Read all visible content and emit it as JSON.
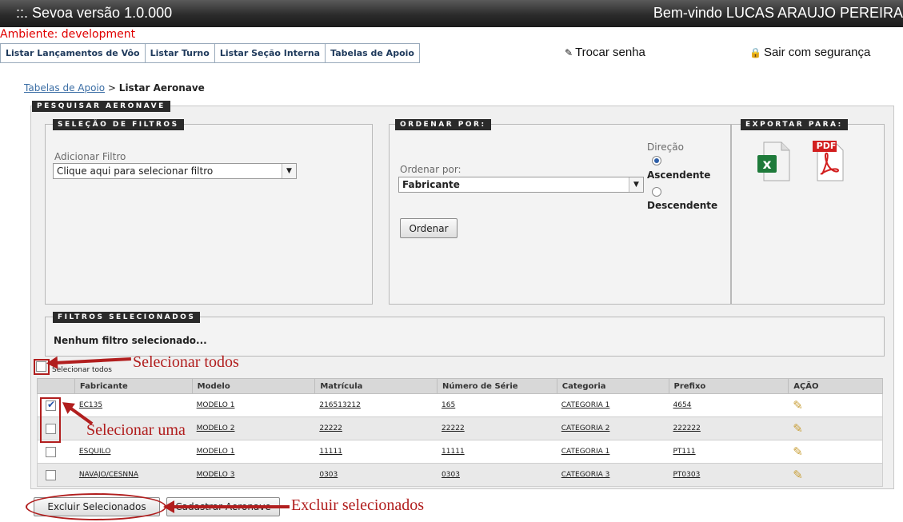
{
  "header": {
    "title": "::.  Sevoa versão 1.0.000",
    "welcome": "Bem-vindo LUCAS ARAUJO PEREIRA"
  },
  "environment": "Ambiente: development",
  "nav": [
    {
      "label": "Listar Lançamentos de Vôo"
    },
    {
      "label": "Listar Turno"
    },
    {
      "label": "Listar Seção Interna"
    },
    {
      "label": "Tabelas de Apoio"
    }
  ],
  "utility": {
    "change_password": "Trocar senha",
    "logout": "Sair com segurança"
  },
  "breadcrumb": {
    "parent": "Tabelas de Apoio",
    "separator": " > ",
    "current": "Listar Aeronave"
  },
  "search": {
    "legend": "PESQUISAR AERONAVE",
    "filters": {
      "legend": "SELEÇÃO DE FILTROS",
      "add_label": "Adicionar Filtro",
      "select_value": "Clique aqui para selecionar filtro"
    },
    "order": {
      "legend": "ORDENAR POR:",
      "label": "Ordenar por:",
      "select_value": "Fabricante",
      "direction_label": "Direção",
      "asc": "Ascendente",
      "desc": "Descendente",
      "button": "Ordenar"
    },
    "export": {
      "legend": "EXPORTAR PARA:",
      "pdf_label": "PDF"
    },
    "selected_filters": {
      "legend": "FILTROS SELECIONADOS",
      "empty": "Nenhum filtro selecionado..."
    }
  },
  "select_all_label": "Selecionar todos",
  "table": {
    "headers": [
      "Fabricante",
      "Modelo",
      "Matrícula",
      "Número de Série",
      "Categoria",
      "Prefixo",
      "AÇÃO"
    ],
    "rows": [
      {
        "checked": true,
        "cells": [
          "EC135",
          "MODELO 1",
          "216513212",
          "165",
          "CATEGORIA 1",
          "4654"
        ]
      },
      {
        "checked": false,
        "cells": [
          "",
          "MODELO 2",
          "22222",
          "22222",
          "CATEGORIA 2",
          "222222"
        ]
      },
      {
        "checked": false,
        "cells": [
          "ESQUILO",
          "MODELO 1",
          "11111",
          "11111",
          "CATEGORIA 1",
          "PT111"
        ]
      },
      {
        "checked": false,
        "cells": [
          "NAVAJO/CESNNA",
          "MODELO 3",
          "0303",
          "0303",
          "CATEGORIA 3",
          "PT0303"
        ]
      }
    ]
  },
  "actions": {
    "delete_selected": "Excluir Selecionados",
    "register": "Cadastrar Aeronave"
  },
  "annotations": {
    "select_all": "Selecionar todos",
    "select_one": "Selecionar uma",
    "delete_selected": "Excluir selecionados"
  },
  "colors": {
    "annotation": "#b11e1e",
    "environment": "#e00000",
    "header_bg": "#2b2b2b"
  }
}
